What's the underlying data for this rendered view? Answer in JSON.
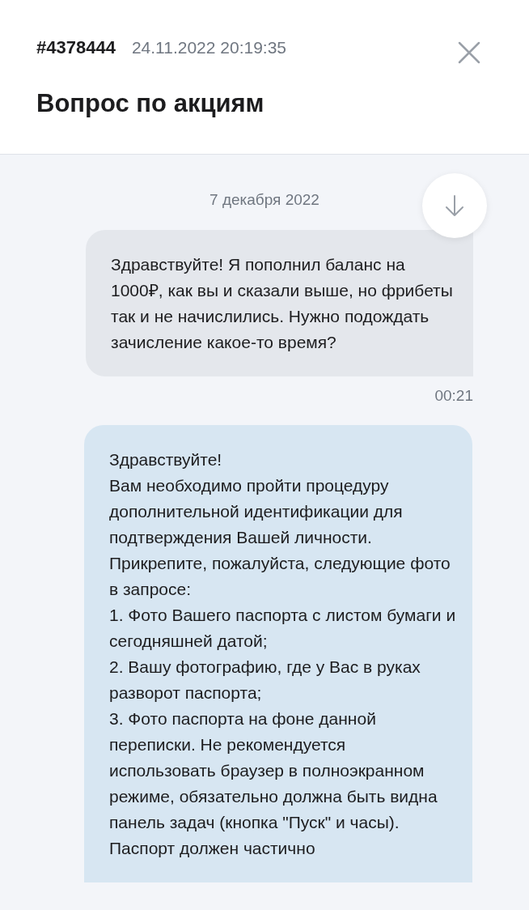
{
  "header": {
    "ticket_id": "#4378444",
    "datetime": "24.11.2022 20:19:35",
    "title": "Вопрос по акциям"
  },
  "chat": {
    "date": "7 декабря 2022",
    "messages": [
      {
        "kind": "outgoing",
        "text": "Здравствуйте! Я пополнил баланс на 1000₽, как вы и сказали выше, но фрибеты так и не начислились. Нужно подождать зачисление какое-то время?",
        "time": "00:21"
      },
      {
        "kind": "incoming",
        "text": "Здравствуйте!\nВам необходимо пройти процедуру дополнительной идентификации для подтверждения Вашей личности. Прикрепите, пожалуйста, следующие фото в запросе:\n1. Фото Вашего паспорта с листом бумаги и сегодняшней датой;\n2. Вашу фотографию, где у Вас в руках разворот паспорта;\n3. Фото паспорта на фоне данной переписки. Не рекомендуется использовать браузер в полноэкранном режиме, обязательно должна быть видна панель задач (кнопка \"Пуск\" и часы). Паспорт должен частично"
      }
    ]
  }
}
